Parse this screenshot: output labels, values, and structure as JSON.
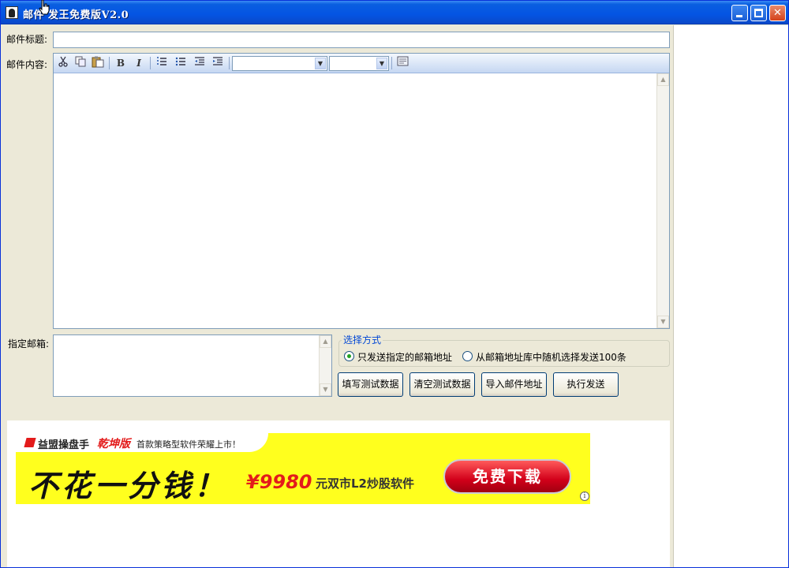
{
  "window": {
    "title": "邮件 发王免费版V2.0",
    "controls": {
      "minimize": "minimize",
      "maximize": "maximize",
      "close": "✕"
    }
  },
  "form": {
    "subject_label": "邮件标题:",
    "subject_value": "",
    "content_label": "邮件内容:",
    "recipients_label": "指定邮箱:",
    "recipients_value": ""
  },
  "toolbar": {
    "icons": [
      "cut-icon",
      "copy-icon",
      "paste-icon",
      "bold-icon",
      "italic-icon",
      "ordered-list-icon",
      "unordered-list-icon",
      "outdent-icon",
      "indent-icon",
      "insert-image-icon"
    ],
    "bold": "B",
    "italic": "I",
    "font_select": "",
    "size_select": ""
  },
  "selection": {
    "legend": "选择方式",
    "option1": "只发送指定的邮箱地址",
    "option2": "从邮箱地址库中随机选择发送100条",
    "selected": 1
  },
  "buttons": {
    "fill_test": "填写测试数据",
    "clear_test": "清空测试数据",
    "import": "导入邮件地址",
    "send": "执行发送"
  },
  "ad": {
    "brand": "益盟操盘手",
    "edition": "乾坤版",
    "slogan": "首款策略型软件荣耀上市！",
    "headline": "不花一分钱！",
    "price": "¥9980",
    "price_desc": "元双市L2炒股软件",
    "cta": "免费下载",
    "info": "i"
  },
  "colors": {
    "titlebar": "#0454e3",
    "dialog_bg": "#ece9d8",
    "ad_yellow": "#ffff1e",
    "ad_red": "#e31b1b",
    "legend_blue": "#0046d5"
  }
}
